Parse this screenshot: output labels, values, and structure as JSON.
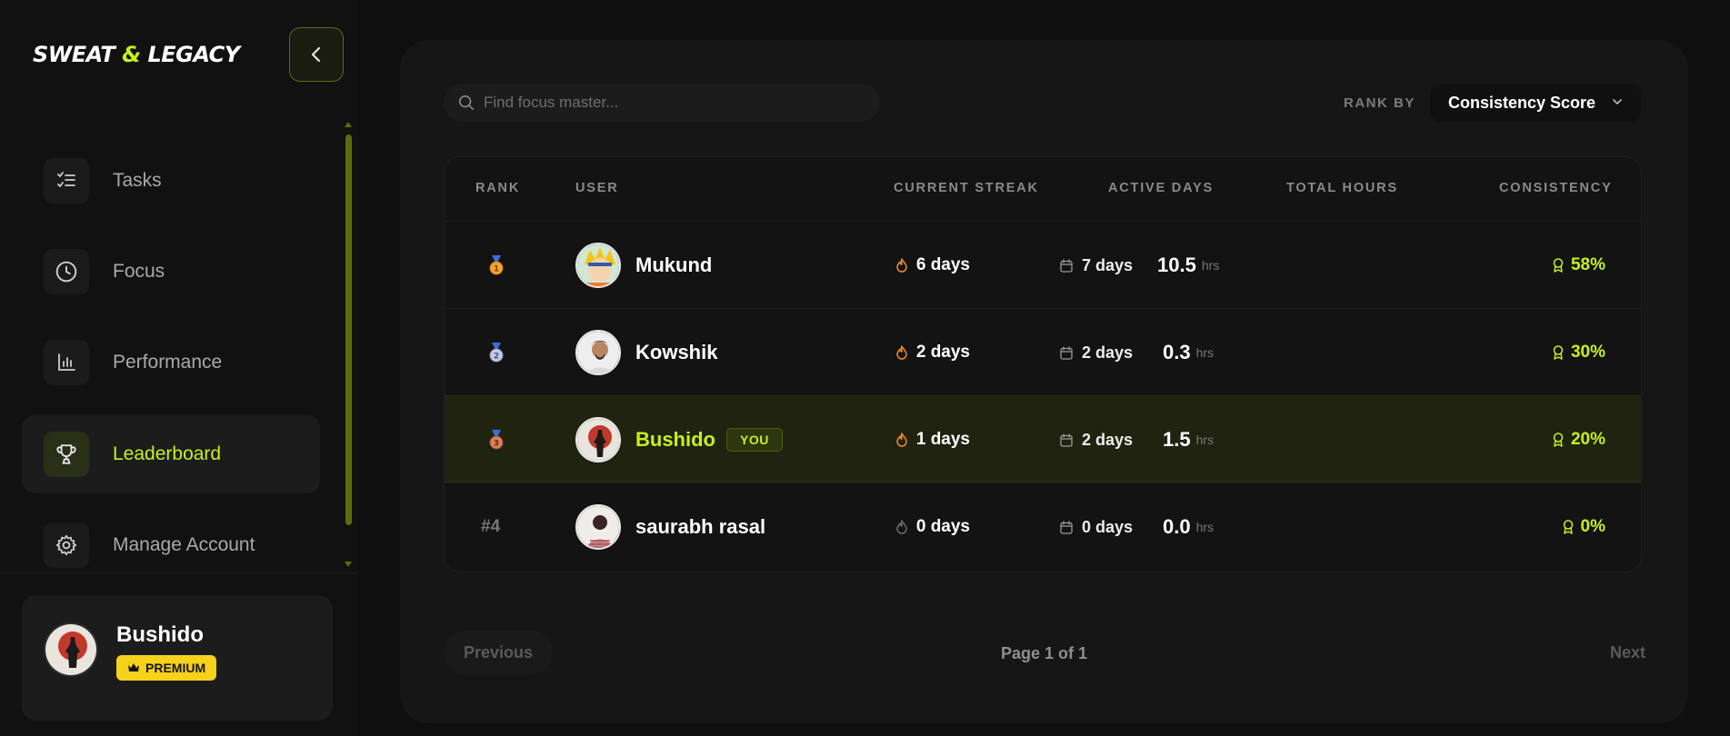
{
  "brand": {
    "part1": "SWEAT ",
    "amp": "&",
    "part2": " LEGACY"
  },
  "sidebar": {
    "items": [
      {
        "label": "Tasks",
        "icon": "tasks-icon"
      },
      {
        "label": "Focus",
        "icon": "clock-icon"
      },
      {
        "label": "Performance",
        "icon": "bar-chart-icon"
      },
      {
        "label": "Leaderboard",
        "icon": "trophy-icon",
        "active": true
      },
      {
        "label": "Manage Account",
        "icon": "gear-icon"
      }
    ],
    "profile": {
      "name": "Bushido",
      "badge": "PREMIUM"
    }
  },
  "search": {
    "placeholder": "Find focus master..."
  },
  "rank_by": {
    "label": "RANK BY",
    "value": "Consistency Score"
  },
  "table": {
    "headers": {
      "rank": "RANK",
      "user": "USER",
      "streak": "CURRENT STREAK",
      "active_days": "ACTIVE DAYS",
      "total_hours": "TOTAL HOURS",
      "consistency": "CONSISTENCY"
    },
    "rows": [
      {
        "rank": "1",
        "medal": "gold-medal-icon",
        "name": "Mukund",
        "streak": "6 days",
        "active_days": "7 days",
        "hours": "10.5",
        "hours_unit": "hrs",
        "consistency": "58%"
      },
      {
        "rank": "2",
        "medal": "silver-medal-icon",
        "name": "Kowshik",
        "streak": "2 days",
        "active_days": "2 days",
        "hours": "0.3",
        "hours_unit": "hrs",
        "consistency": "30%"
      },
      {
        "rank": "3",
        "medal": "bronze-medal-icon",
        "name": "Bushido",
        "you_tag": "YOU",
        "streak": "1 days",
        "active_days": "2 days",
        "hours": "1.5",
        "hours_unit": "hrs",
        "consistency": "20%"
      },
      {
        "rank": "#4",
        "name": "saurabh rasal",
        "streak": "0 days",
        "active_days": "0 days",
        "hours": "0.0",
        "hours_unit": "hrs",
        "consistency": "0%"
      }
    ]
  },
  "pagination": {
    "prev": "Previous",
    "info": "Page 1 of 1",
    "next": "Next"
  },
  "colors": {
    "accent": "#c6f01c",
    "premium": "#f7d21c",
    "flame": "#f08a24"
  }
}
